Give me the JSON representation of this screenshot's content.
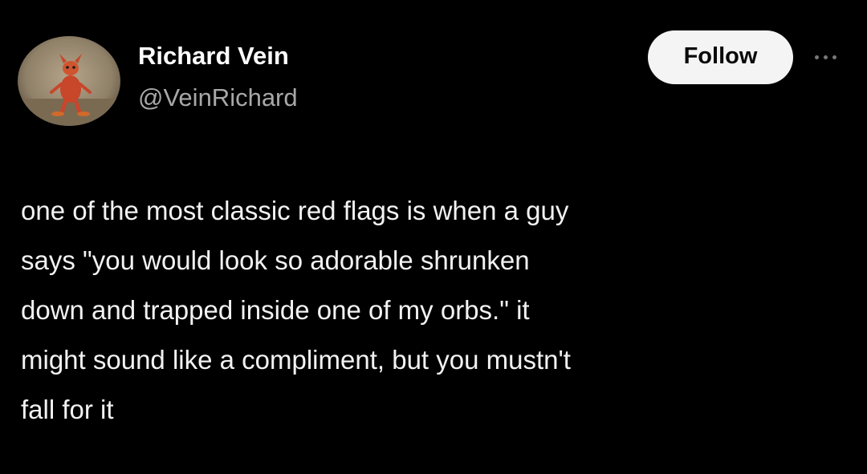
{
  "user": {
    "display_name": "Richard Vein",
    "handle": "@VeinRichard",
    "avatar_icon": "avatar-cartoon-character"
  },
  "actions": {
    "follow_label": "Follow",
    "more_icon": "more-horizontal-icon"
  },
  "tweet": {
    "lines": [
      "one of the most classic red flags is when a guy",
      "says \"you would look so adorable shrunken",
      "down and trapped inside one of my orbs.\" it",
      "might sound like a compliment, but you mustn't",
      "fall for it"
    ]
  },
  "colors": {
    "background": "#000000",
    "text": "#f2f2f2",
    "handle": "#a8a8a8",
    "follow_bg": "#f4f4f4",
    "follow_text": "#0a0a0a"
  }
}
